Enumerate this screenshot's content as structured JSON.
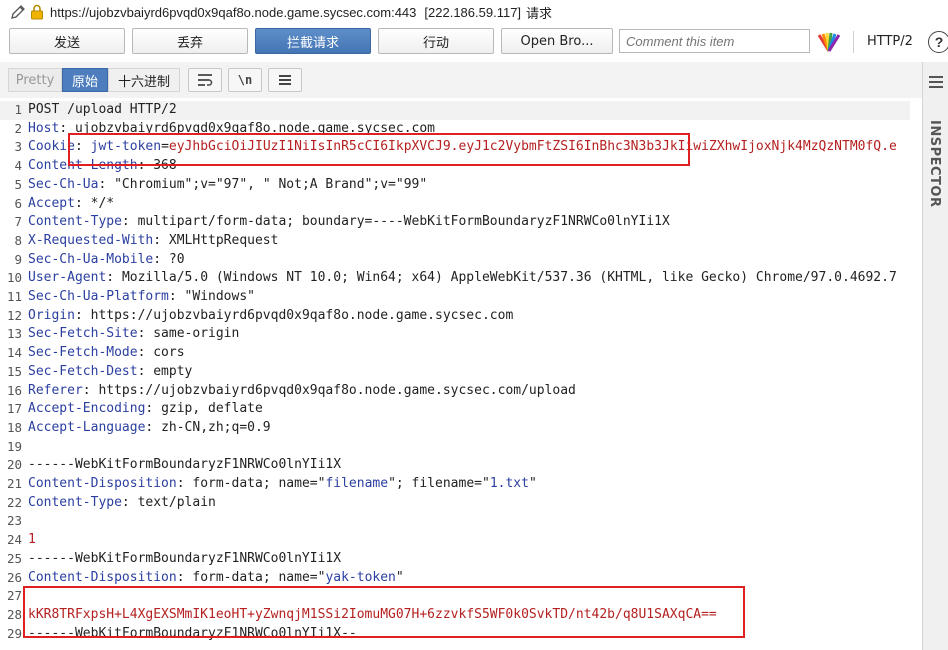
{
  "url_bar": {
    "url": "https://ujobzvbaiyrd6pvqd0x9qaf8o.node.game.sycsec.com:443",
    "ip": "[222.186.59.117]",
    "kind": "请求"
  },
  "toolbar": {
    "send": "发送",
    "drop": "丢弃",
    "intercept": "拦截请求",
    "action": "行动",
    "open_browser": "Open Bro...",
    "comment_placeholder": "Comment this item",
    "protocol": "HTTP/2",
    "help": "?"
  },
  "tabs": {
    "pretty": "Pretty",
    "raw": "原始",
    "hex": "十六进制",
    "newline_tool": "\\n"
  },
  "inspector": {
    "label": "INSPECTOR"
  },
  "request_lines": [
    {
      "n": "1",
      "t": "POST /upload HTTP/2"
    },
    {
      "n": "2",
      "h": "Host",
      "v": "ujobzvbaiyrd6pvqd0x9qaf8o.node.game.sycsec.com"
    },
    {
      "n": "3",
      "h": "Cookie",
      "k": "jwt-token",
      "v": "eyJhbGciOiJIUzI1NiIsInR5cCI6IkpXVCJ9.eyJ1c2VybmFtZSI6InBhc3N3b3JkIiwiZXhwIjoxNjk4MzQzNTM0fQ.e"
    },
    {
      "n": "4",
      "h": "Content-Length",
      "v": "368"
    },
    {
      "n": "5",
      "h": "Sec-Ch-Ua",
      "v": "\"Chromium\";v=\"97\", \" Not;A Brand\";v=\"99\""
    },
    {
      "n": "6",
      "h": "Accept",
      "v": "*/*"
    },
    {
      "n": "7",
      "h": "Content-Type",
      "v": "multipart/form-data; boundary=----WebKitFormBoundaryzF1NRWCo0lnYIi1X"
    },
    {
      "n": "8",
      "h": "X-Requested-With",
      "v": "XMLHttpRequest"
    },
    {
      "n": "9",
      "h": "Sec-Ch-Ua-Mobile",
      "v": "?0"
    },
    {
      "n": "10",
      "h": "User-Agent",
      "v": "Mozilla/5.0 (Windows NT 10.0; Win64; x64) AppleWebKit/537.36 (KHTML, like Gecko) Chrome/97.0.4692.7"
    },
    {
      "n": "11",
      "h": "Sec-Ch-Ua-Platform",
      "v": "\"Windows\""
    },
    {
      "n": "12",
      "h": "Origin",
      "v": "https://ujobzvbaiyrd6pvqd0x9qaf8o.node.game.sycsec.com"
    },
    {
      "n": "13",
      "h": "Sec-Fetch-Site",
      "v": "same-origin"
    },
    {
      "n": "14",
      "h": "Sec-Fetch-Mode",
      "v": "cors"
    },
    {
      "n": "15",
      "h": "Sec-Fetch-Dest",
      "v": "empty"
    },
    {
      "n": "16",
      "h": "Referer",
      "v": "https://ujobzvbaiyrd6pvqd0x9qaf8o.node.game.sycsec.com/upload"
    },
    {
      "n": "17",
      "h": "Accept-Encoding",
      "v": "gzip, deflate"
    },
    {
      "n": "18",
      "h": "Accept-Language",
      "v": "zh-CN,zh;q=0.9"
    },
    {
      "n": "19",
      "t": ""
    },
    {
      "n": "20",
      "t": "------WebKitFormBoundaryzF1NRWCo0lnYIi1X"
    },
    {
      "n": "21",
      "h": "Content-Disposition",
      "v": "form-data; name=\"",
      "p1": "filename",
      "m": "\"; filename=\"",
      "p2": "1.txt",
      "e": "\""
    },
    {
      "n": "22",
      "h": "Content-Type",
      "v": "text/plain"
    },
    {
      "n": "23",
      "t": ""
    },
    {
      "n": "24",
      "r": "1"
    },
    {
      "n": "25",
      "t": "------WebKitFormBoundaryzF1NRWCo0lnYIi1X"
    },
    {
      "n": "26",
      "h": "Content-Disposition",
      "v": "form-data; name=\"",
      "p1": "yak-token",
      "e": "\""
    },
    {
      "n": "27",
      "t": ""
    },
    {
      "n": "28",
      "r": "kKR8TRFxpsH+L4XgEXSMmIK1eoHT+yZwnqjM1SSi2IomuMG07H+6zzvkfS5WF0k0SvkTD/nt42b/q8U1SAXqCA=="
    },
    {
      "n": "29",
      "t": "------WebKitFormBoundaryzF1NRWCo0lnYIi1X--"
    }
  ]
}
